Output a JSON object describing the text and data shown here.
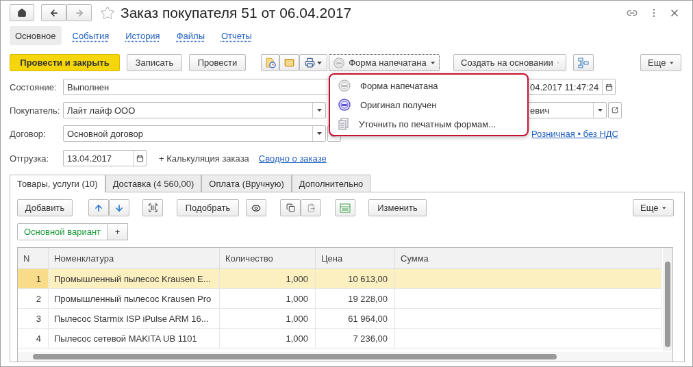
{
  "window": {
    "title": "Заказ покупателя 51 от 06.04.2017"
  },
  "nav_tabs": [
    {
      "label": "Основное",
      "selected": true
    },
    {
      "label": "События",
      "selected": false
    },
    {
      "label": "История",
      "selected": false
    },
    {
      "label": "Файлы",
      "selected": false
    },
    {
      "label": "Отчеты",
      "selected": false
    }
  ],
  "toolbar": {
    "post_and_close": "Провести и закрыть",
    "save": "Записать",
    "post": "Провести",
    "print_status": "Форма напечатана",
    "create_based_on": "Создать на основании",
    "more": "Еще"
  },
  "status_menu": [
    {
      "label": "Форма напечатана",
      "kind": "printed"
    },
    {
      "label": "Оригинал получен",
      "kind": "received"
    },
    {
      "label": "Уточнить по печатным формам...",
      "kind": "clarify"
    }
  ],
  "fields": [
    {
      "label": "Состояние:",
      "value": "Выполнен",
      "kind": "text"
    },
    {
      "label": "Покупатель:",
      "value": "Лайт лайф ООО",
      "kind": "select"
    },
    {
      "label": "Договор:",
      "value": "Основной договор",
      "kind": "select_open"
    },
    {
      "label": "Отгрузка:",
      "value": "13.04.2017",
      "kind": "date"
    }
  ],
  "right_fields": [
    {
      "value": "04.2017 11:47:24",
      "kind": "date"
    },
    {
      "value": "евич",
      "kind": "select_open"
    },
    {
      "value": "Розничная • без НДС",
      "kind": "link"
    }
  ],
  "calculation": "+ Калькуляция заказа",
  "summary_link": "Сводно о заказе",
  "tabs": [
    {
      "label": "Товары, услуги (10)",
      "selected": true
    },
    {
      "label": "Доставка (4 560,00)",
      "selected": false
    },
    {
      "label": "Оплата (Вручную)",
      "selected": false
    },
    {
      "label": "Дополнительно",
      "selected": false
    }
  ],
  "table_toolbar": {
    "add": "Добавить",
    "pick": "Подобрать",
    "change": "Изменить",
    "more": "Еще"
  },
  "variants": {
    "label": "Основной вариант",
    "add": "+"
  },
  "table": {
    "columns": [
      "N",
      "Номенклатура",
      "Количество",
      "Цена",
      "Сумма"
    ],
    "rows": [
      {
        "cells": [
          "1",
          "Промышленный пылесос Krausen E...",
          "1,000",
          "10 613,00",
          ""
        ],
        "selected": true
      },
      {
        "cells": [
          "2",
          "Промышленный пылесос Krausen Pro",
          "1,000",
          "19 228,00",
          ""
        ],
        "selected": false
      },
      {
        "cells": [
          "3",
          "Пылесос Starmix ISP iPulse ARM 16...",
          "1,000",
          "61 964,00",
          ""
        ],
        "selected": false
      },
      {
        "cells": [
          "4",
          "Пылесос сетевой MAKITA UB 1101",
          "1,000",
          "7 236,00",
          ""
        ],
        "selected": false
      }
    ]
  }
}
